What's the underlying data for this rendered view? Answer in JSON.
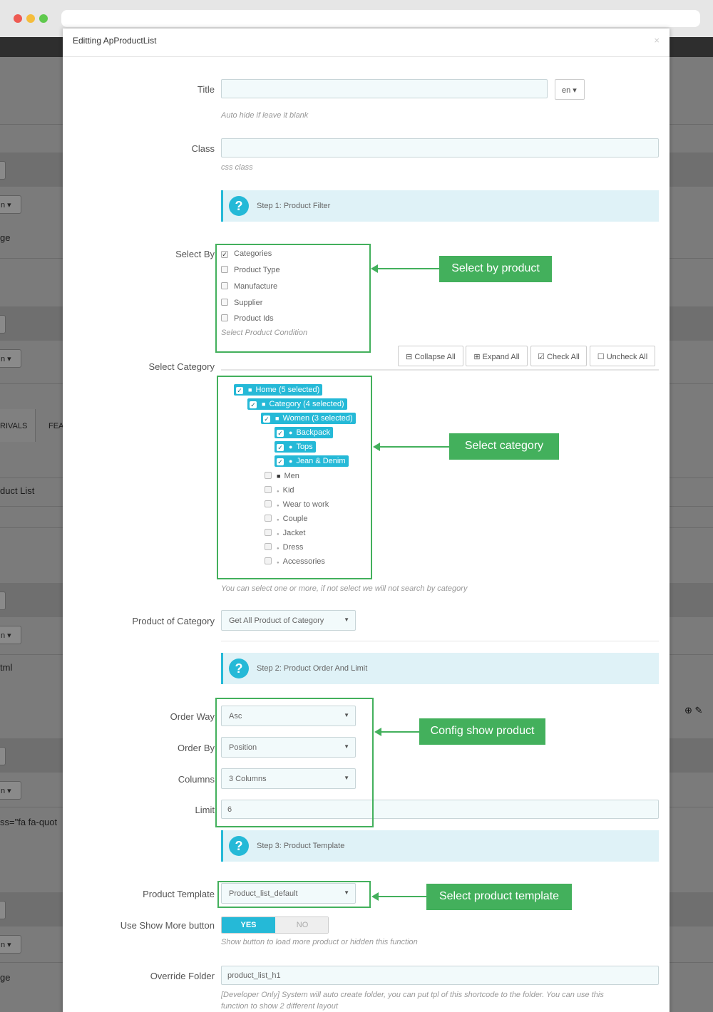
{
  "modal": {
    "title": "Editting ApProductList",
    "close_label": "×"
  },
  "background": {
    "tab_rivals": "RIVALS",
    "tab_fea": "FEA",
    "text_page": "ge",
    "text_product_list": "duct List",
    "text_html": "tml",
    "text_code": "ss=\"fa fa-quot",
    "text_page2": "ge",
    "btn_dropdown": "n ▾",
    "icons": "⊕ ✎"
  },
  "form": {
    "title_label": "Title",
    "title_value": "",
    "lang_button": "en ▾",
    "title_help": "Auto hide if leave it blank",
    "class_label": "Class",
    "class_value": "",
    "class_help": "css class",
    "step1": "Step 1: Product Filter",
    "select_by_label": "Select By",
    "select_by_options": [
      {
        "label": "Categories",
        "checked": true
      },
      {
        "label": "Product Type",
        "checked": false
      },
      {
        "label": "Manufacture",
        "checked": false
      },
      {
        "label": "Supplier",
        "checked": false
      },
      {
        "label": "Product Ids",
        "checked": false
      }
    ],
    "select_by_help": "Select Product Condition",
    "select_category_label": "Select Category",
    "tree_buttons": {
      "collapse": "⊟ Collapse All",
      "expand": "⊞ Expand All",
      "check": "☑ Check All",
      "uncheck": "☐ Uncheck All"
    },
    "tree": [
      {
        "label": "Home (5 selected)",
        "selected": true,
        "icon": "folder"
      },
      {
        "label": "Category (4 selected)",
        "selected": true,
        "icon": "folder-open"
      },
      {
        "label": "Women (3 selected)",
        "selected": true,
        "icon": "folder-open"
      },
      {
        "label": "Backpack",
        "selected": true,
        "icon": "bullet"
      },
      {
        "label": "Tops",
        "selected": true,
        "icon": "bullet"
      },
      {
        "label": "Jean & Denim",
        "selected": true,
        "icon": "bullet"
      },
      {
        "label": "Men",
        "selected": false,
        "icon": "folder"
      },
      {
        "label": "Kid",
        "selected": false,
        "icon": "bullet"
      },
      {
        "label": "Wear to work",
        "selected": false,
        "icon": "bullet"
      },
      {
        "label": "Couple",
        "selected": false,
        "icon": "bullet"
      },
      {
        "label": "Jacket",
        "selected": false,
        "icon": "bullet"
      },
      {
        "label": "Dress",
        "selected": false,
        "icon": "bullet"
      },
      {
        "label": "Accessories",
        "selected": false,
        "icon": "bullet"
      }
    ],
    "category_help": "You can select one or more, if not select we will not search by category",
    "product_of_category_label": "Product of Category",
    "product_of_category_value": "Get All Product of Category",
    "step2": "Step 2: Product Order And Limit",
    "order_way_label": "Order Way",
    "order_way_value": "Asc",
    "order_by_label": "Order By",
    "order_by_value": "Position",
    "columns_label": "Columns",
    "columns_value": "3 Columns",
    "limit_label": "Limit",
    "limit_value": "6",
    "step3": "Step 3: Product Template",
    "product_template_label": "Product Template",
    "product_template_value": "Product_list_default",
    "show_more_label": "Use Show More button",
    "show_more_yes": "YES",
    "show_more_no": "NO",
    "show_more_help": "Show button to load more product or hidden this function",
    "override_label": "Override Folder",
    "override_value": "product_list_h1",
    "override_help_1": "[Developer Only] System will auto create folder, you can put tpl of this shortcode to the folder. You can use this",
    "override_help_2": "function to show 2 different layout"
  },
  "annotations": {
    "select_by_product": "Select by product",
    "select_category": "Select category",
    "config_show_product": "Config show product",
    "select_product_template": "Select product template"
  },
  "colors": {
    "accent": "#25b9d7",
    "annotation_green": "#43b05c"
  }
}
